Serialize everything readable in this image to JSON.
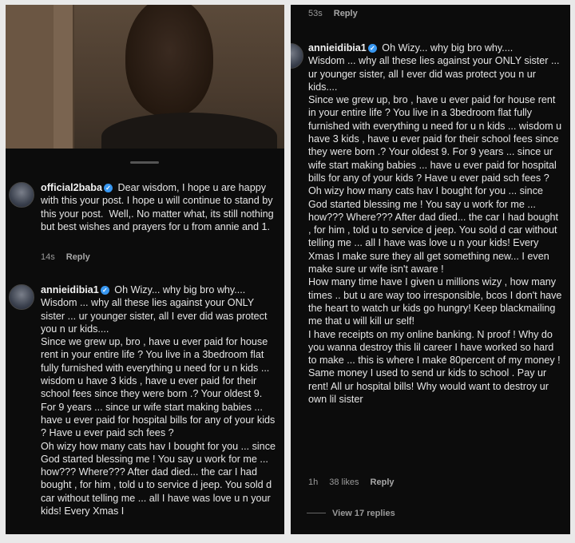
{
  "left": {
    "comment1": {
      "username": "official2baba",
      "text": "Dear wisdom, I hope u are happy with this your post. I hope u will continue to stand by this your post.  Well,. No matter what, its still nothing but best wishes and prayers for u from annie and 1.",
      "time": "14s",
      "reply_label": "Reply"
    },
    "comment2": {
      "username": "annieidibia1",
      "text": "Oh Wizy... why big bro why....\nWisdom ... why all these lies against your ONLY sister ... ur younger sister, all I ever did was protect you n ur kids....\nSince we grew up, bro , have u ever paid for house rent in your entire life ? You live in a 3bedroom flat fully furnished with everything u need for u n kids ... wisdom u have 3 kids , have u ever paid for their school fees since they were born .? Your oldest 9. For 9 years ... since ur wife start making babies ... have u ever paid for hospital bills for any of your kids ? Have u ever paid sch fees ?\nOh wizy how many cats hav I bought for you ... since God started blessing me ! You say u work for me ... how??? Where??? After dad died... the car I had bought , for him , told u to service d jeep. You sold d car without telling me ... all I have was love u n your kids! Every Xmas I"
    }
  },
  "right": {
    "top_meta": {
      "time": "53s",
      "reply_label": "Reply"
    },
    "comment": {
      "username": "annieidibia1",
      "text": "Oh Wizy... why big bro why....\nWisdom ... why all these lies against your ONLY sister ... ur younger sister, all I ever did was protect you n ur kids....\nSince we grew up, bro , have u ever paid for house rent in your entire life ? You live in a 3bedroom flat fully furnished with everything u need for u n kids ... wisdom u have 3 kids , have u ever paid for their school fees since they were born .? Your oldest 9. For 9 years ... since ur wife start making babies ... have u ever paid for hospital bills for any of your kids ? Have u ever paid sch fees ?\nOh wizy how many cats hav I bought for you ... since God started blessing me ! You say u work for me ... how??? Where??? After dad died... the car I had bought , for him , told u to service d jeep. You sold d car without telling me ... all I have was love u n your kids! Every Xmas I make sure they all get something new... I even make sure ur wife isn't aware !\nHow many time have I given u millions wizy , how many times .. but u are way too irresponsible, bcos I don't have the heart to watch ur kids go hungry! Keep blackmailing me that u will kill ur self!\nI have receipts on my online banking. N proof ! Why do you wanna destroy this lil career I have worked so hard to make ... this is where I make 80percent of my money ! Same money I used to send ur kids to school . Pay ur rent! All ur hospital bills! Why would want to destroy ur own lil sister",
      "time": "1h",
      "likes": "38 likes",
      "reply_label": "Reply"
    },
    "view_replies": "View 17 replies"
  },
  "colors": {
    "background": "#0c0c0c",
    "text": "#e6e6e6",
    "verified": "#3897f0",
    "muted": "#9a9a9a"
  },
  "icons": {
    "verified": "verified-badge-icon"
  }
}
